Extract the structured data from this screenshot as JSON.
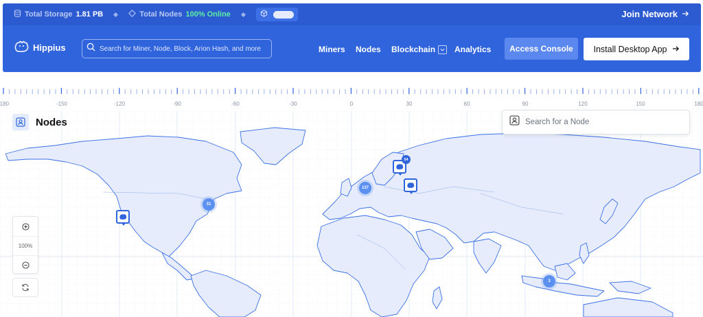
{
  "statusbar": {
    "storage_label": "Total Storage",
    "storage_value": "1.81 PB",
    "nodes_label": "Total Nodes",
    "nodes_value": "100% Online",
    "join_label": "Join Network"
  },
  "nav": {
    "brand": "Hippius",
    "search_placeholder": "Search for Miner, Node, Block, Arion Hash, and more",
    "items": [
      "Miners",
      "Nodes",
      "Blockchain",
      "Analytics"
    ],
    "console_label": "Access Console",
    "install_label": "Install Desktop App"
  },
  "map": {
    "title": "Nodes",
    "search_placeholder": "Search for a Node",
    "zoom_level": "100%",
    "longitude_ticks": [
      "-180",
      "-150",
      "-120",
      "-90",
      "-60",
      "-30",
      "0",
      "30",
      "60",
      "90",
      "120",
      "150",
      "180"
    ],
    "clusters": [
      {
        "id": "us-east",
        "count": "31"
      },
      {
        "id": "europe-west",
        "count": "137"
      },
      {
        "id": "southeast-asia",
        "count": "3"
      }
    ],
    "pins": [
      {
        "id": "us-west"
      },
      {
        "id": "scandinavia",
        "badge": "54"
      },
      {
        "id": "eastern-europe"
      }
    ]
  },
  "colors": {
    "brand_blue": "#2f64dd",
    "online_green": "#5ef0a0",
    "land_fill": "#e6ecfb",
    "land_stroke": "#3a6fe6"
  }
}
